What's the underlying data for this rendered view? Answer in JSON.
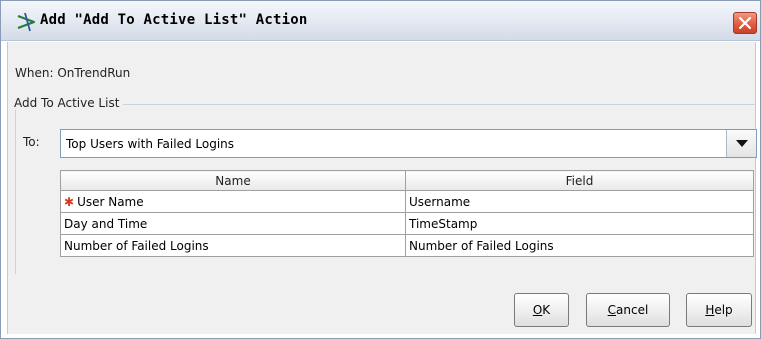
{
  "window": {
    "title": "Add \"Add To Active List\" Action",
    "icon": "lambda-action-icon",
    "close_icon": "close-icon"
  },
  "when_label": "When: OnTrendRun",
  "group": {
    "legend": "Add To Active List",
    "to_label": "To:",
    "to_value": "Top Users with Failed Logins",
    "dropdown_icon": "chevron-down-icon"
  },
  "table": {
    "headers": [
      "Name",
      "Field"
    ],
    "rows": [
      {
        "name": "User Name",
        "field": "Username",
        "required": true
      },
      {
        "name": "Day and Time",
        "field": "TimeStamp",
        "required": false
      },
      {
        "name": "Number of Failed Logins",
        "field": "Number of Failed Logins",
        "required": false
      }
    ],
    "required_marker": "✱"
  },
  "buttons": {
    "ok": {
      "mnemonic": "O",
      "rest": "K"
    },
    "cancel": {
      "mnemonic": "C",
      "rest": "ancel"
    },
    "help": {
      "mnemonic": "H",
      "rest": "elp"
    }
  },
  "colors": {
    "title_gradient_top": "#f4f6fa",
    "close_button": "#e0573a",
    "required_marker": "#d23c1e"
  }
}
